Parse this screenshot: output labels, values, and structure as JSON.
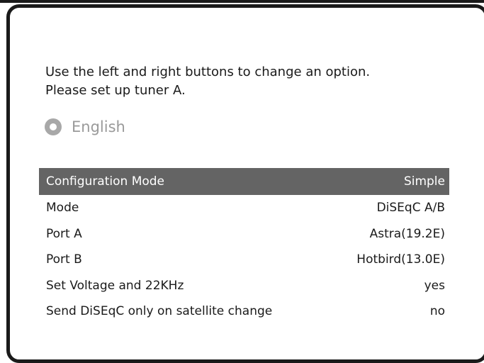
{
  "instructions": {
    "line1": "Use the left and right buttons to change an option.",
    "line2": "Please set up tuner A."
  },
  "language": {
    "icon": "radio-icon",
    "label": "English"
  },
  "settings": [
    {
      "label": "Configuration Mode",
      "value": "Simple",
      "selected": true
    },
    {
      "label": "Mode",
      "value": "DiSEqC A/B"
    },
    {
      "label": "Port A",
      "value": "Astra(19.2E)"
    },
    {
      "label": "Port B",
      "value": "Hotbird(13.0E)"
    },
    {
      "label": "Set Voltage and 22KHz",
      "value": "yes"
    },
    {
      "label": "Send DiSEqC only on satellite change",
      "value": "no"
    }
  ],
  "colors": {
    "selected_row_bg": "#646464",
    "frame": "#1a1a1a",
    "disabled_text": "#9a9a9a"
  }
}
